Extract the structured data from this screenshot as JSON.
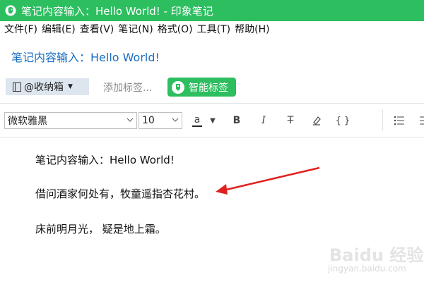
{
  "window": {
    "title": "笔记内容输入：Hello World! - 印象笔记",
    "app_icon": "evernote-elephant-icon",
    "accent_color": "#2dbe60"
  },
  "menu": [
    "文件(F)",
    "编辑(E)",
    "查看(V)",
    "笔记(N)",
    "格式(O)",
    "工具(T)",
    "帮助(H)"
  ],
  "note": {
    "title": "笔记内容输入：Hello World!",
    "notebook": "@收纳箱",
    "tag_placeholder": "添加标签...",
    "smart_tag_label": "智能标签"
  },
  "toolbar": {
    "font_family": "微软雅黑",
    "font_size": "10",
    "font_color_label": "a",
    "bold_label": "B",
    "italic_label": "I",
    "strikethrough_label": "T",
    "code_label": "{ }"
  },
  "editor": {
    "lines": [
      "笔记内容输入：Hello World!",
      "借问酒家何处有，牧童遥指杏花村。",
      "床前明月光，  疑是地上霜。"
    ]
  },
  "watermark": {
    "text": "Baidu 经验",
    "url": "jingyan.baidu.com"
  }
}
